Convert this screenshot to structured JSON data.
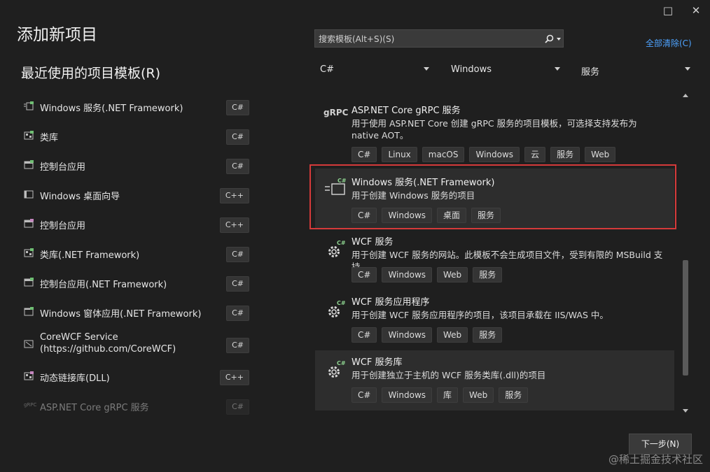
{
  "window": {
    "maximize_icon": "□",
    "close_icon": "✕"
  },
  "page_title": "添加新项目",
  "recent": {
    "title": "最近使用的项目模板(R)",
    "items": [
      {
        "label": "Windows 服务(.NET Framework)",
        "lang": "C#"
      },
      {
        "label": "类库",
        "lang": "C#"
      },
      {
        "label": "控制台应用",
        "lang": "C#"
      },
      {
        "label": "Windows 桌面向导",
        "lang": "C++"
      },
      {
        "label": "控制台应用",
        "lang": "C++"
      },
      {
        "label": "类库(.NET Framework)",
        "lang": "C#"
      },
      {
        "label": "控制台应用(.NET Framework)",
        "lang": "C#"
      },
      {
        "label": "Windows 窗体应用(.NET Framework)",
        "lang": "C#"
      },
      {
        "label": "CoreWCF Service (https://github.com/CoreWCF)",
        "lang": "C#"
      },
      {
        "label": "动态链接库(DLL)",
        "lang": "C++"
      },
      {
        "label": "ASP.NET Core gRPC 服务",
        "lang": "C#"
      }
    ]
  },
  "search": {
    "placeholder": "搜索模板(Alt+S)(S)",
    "value": "",
    "icon": "search-icon"
  },
  "clear_all": "全部清除(C)",
  "filters": {
    "language": "C#",
    "platform": "Windows",
    "project_type": "服务"
  },
  "templates": [
    {
      "icon_text": "gRPC",
      "name": "ASP.NET Core gRPC 服务",
      "desc": "用于使用 ASP.NET Core 创建 gRPC 服务的项目模板，可选择支持发布为 native AOT。",
      "tags": [
        "C#",
        "Linux",
        "macOS",
        "Windows",
        "云",
        "服务",
        "Web"
      ]
    },
    {
      "icon_badge": "C#",
      "name": "Windows 服务(.NET Framework)",
      "desc": "用于创建 Windows 服务的项目",
      "tags": [
        "C#",
        "Windows",
        "桌面",
        "服务"
      ]
    },
    {
      "icon_badge": "C#",
      "name": "WCF 服务",
      "desc": "用于创建 WCF 服务的网站。此模板不会生成项目文件，受到有限的 MSBuild 支持。",
      "tags": [
        "C#",
        "Windows",
        "Web",
        "服务"
      ]
    },
    {
      "icon_badge": "C#",
      "name": "WCF 服务应用程序",
      "desc": "用于创建 WCF 服务应用程序的项目，该项目承载在 IIS/WAS 中。",
      "tags": [
        "C#",
        "Windows",
        "Web",
        "服务"
      ]
    },
    {
      "icon_badge": "C#",
      "name": "WCF 服务库",
      "desc": "用于创建独立于主机的 WCF 服务类库(.dll)的项目",
      "tags": [
        "C#",
        "Windows",
        "库",
        "Web",
        "服务"
      ]
    }
  ],
  "next_button": "下一步(N)",
  "watermark": "@稀土掘金技术社区",
  "colors": {
    "background": "#1f1f1f",
    "accent_link": "#4ea3ff",
    "highlight_border": "#d53a3a"
  }
}
